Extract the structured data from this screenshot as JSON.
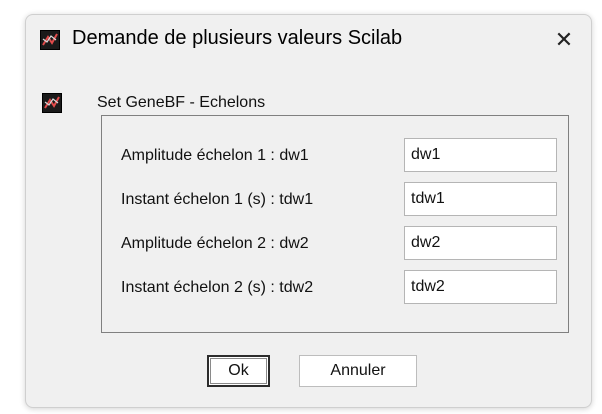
{
  "window": {
    "title": "Demande de plusieurs valeurs Scilab",
    "close_glyph": "✕",
    "app_icon": "scilab-icon"
  },
  "group": {
    "label": "Set GeneBF - Echelons",
    "icon": "scilab-icon"
  },
  "fields": [
    {
      "label": "Amplitude échelon 1 : dw1",
      "value": "dw1"
    },
    {
      "label": "Instant échelon 1 (s) : tdw1",
      "value": "tdw1"
    },
    {
      "label": "Amplitude échelon 2 : dw2",
      "value": "dw2"
    },
    {
      "label": "Instant échelon 2 (s) : tdw2",
      "value": "tdw2"
    }
  ],
  "buttons": {
    "ok_label": "Ok",
    "cancel_label": "Annuler"
  },
  "colors": {
    "dialog_background": "#f0f0f0",
    "input_background": "#ffffff",
    "fieldset_border": "#808080"
  }
}
